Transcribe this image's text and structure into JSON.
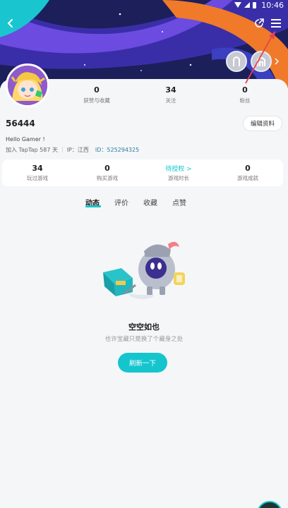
{
  "status_bar": {
    "time": "10:46"
  },
  "header": {
    "back_icon": "back-arrow-icon",
    "share_icon": "share-icon",
    "menu_icon": "menu-icon"
  },
  "profile": {
    "username": "56444",
    "bio": "Hello Gamer !",
    "joined": "加入 TapTap 587 天",
    "ip": "IP：江西",
    "id": "ID：525294325",
    "edit_label": "编辑资料"
  },
  "stats": [
    {
      "value": "0",
      "label": "获赞与收藏"
    },
    {
      "value": "34",
      "label": "关注"
    },
    {
      "value": "0",
      "label": "粉丝"
    }
  ],
  "game_stats": [
    {
      "value": "34",
      "label": "玩过游戏"
    },
    {
      "value": "0",
      "label": "购买游戏"
    },
    {
      "value": "待授权 >",
      "label": "游戏时长"
    },
    {
      "value": "0",
      "label": "游戏成就"
    }
  ],
  "tabs": [
    {
      "label": "动态",
      "active": true
    },
    {
      "label": "评价",
      "active": false
    },
    {
      "label": "收藏",
      "active": false
    },
    {
      "label": "点赞",
      "active": false
    }
  ],
  "empty_state": {
    "title": "空空如也",
    "subtitle": "也许宝藏只是换了个藏身之处",
    "refresh_label": "刷新一下"
  },
  "colors": {
    "accent": "#15c5ce",
    "banner": "#1c1f5a",
    "annotation_arrow": "#e8424e"
  }
}
